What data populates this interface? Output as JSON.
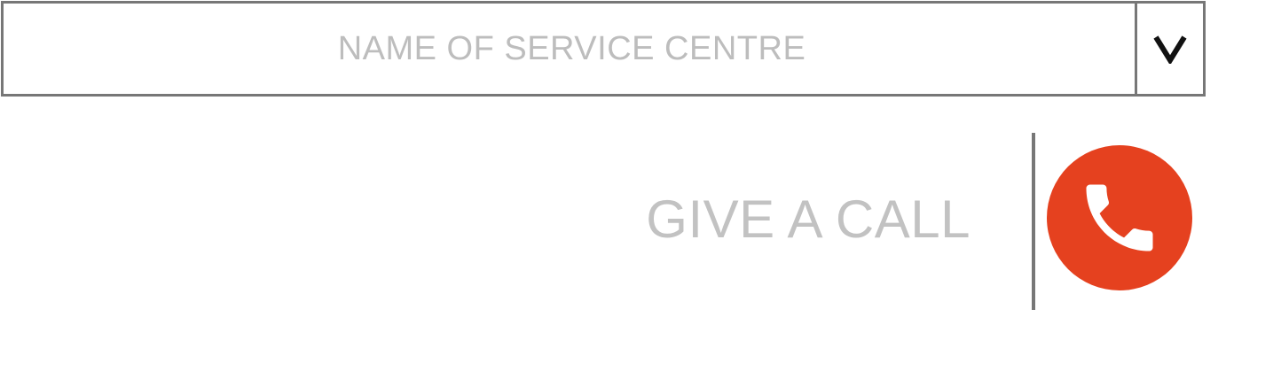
{
  "service_select": {
    "placeholder": "NAME OF SERVICE CENTRE",
    "toggle_icon": "chevron-down-icon"
  },
  "call": {
    "label": "GIVE A CALL",
    "icon": "phone-icon"
  },
  "colors": {
    "border": "#777777",
    "placeholder_text": "#bdbdbd",
    "call_label_text": "#c2c2c2",
    "divider": "#777777",
    "call_button_bg": "#e5411f",
    "icon_fg": "#ffffff",
    "toggle_fg": "#111111"
  }
}
